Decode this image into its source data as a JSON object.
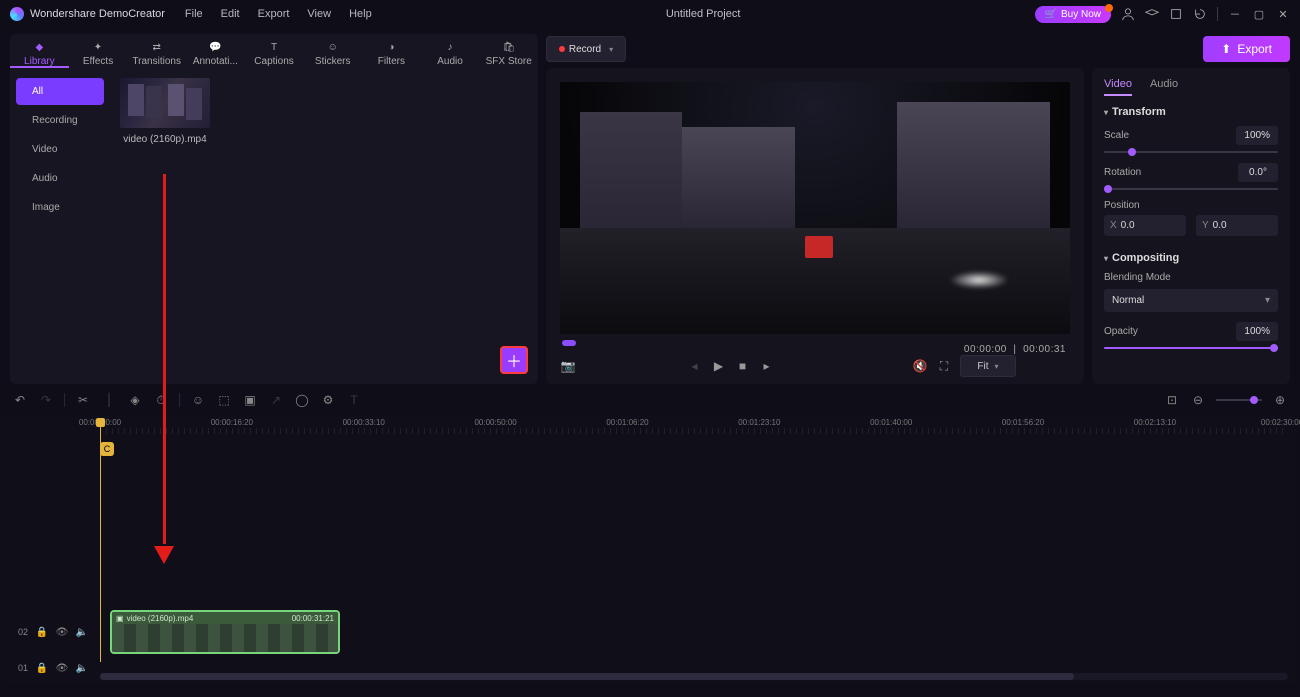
{
  "titlebar": {
    "app": "Wondershare DemoCreator",
    "menus": [
      "File",
      "Edit",
      "Export",
      "View",
      "Help"
    ],
    "project": "Untitled Project",
    "buy": "Buy Now"
  },
  "tabs": [
    {
      "id": "library",
      "label": "Library",
      "active": true
    },
    {
      "id": "effects",
      "label": "Effects"
    },
    {
      "id": "transitions",
      "label": "Transitions"
    },
    {
      "id": "annotations",
      "label": "Annotati..."
    },
    {
      "id": "captions",
      "label": "Captions"
    },
    {
      "id": "stickers",
      "label": "Stickers"
    },
    {
      "id": "filters",
      "label": "Filters"
    },
    {
      "id": "audio",
      "label": "Audio"
    },
    {
      "id": "sfx",
      "label": "SFX Store"
    }
  ],
  "record": {
    "label": "Record"
  },
  "export": {
    "label": "Export"
  },
  "library": {
    "categories": [
      {
        "label": "All",
        "active": true
      },
      {
        "label": "Recording"
      },
      {
        "label": "Video"
      },
      {
        "label": "Audio"
      },
      {
        "label": "Image"
      }
    ],
    "thumb_name": "video (2160p).mp4"
  },
  "preview": {
    "time_current": "00:00:00",
    "time_total": "00:00:31",
    "fit": "Fit"
  },
  "props": {
    "tabs": [
      "Video",
      "Audio"
    ],
    "transform": {
      "title": "Transform",
      "scale_label": "Scale",
      "scale_value": "100%",
      "rotation_label": "Rotation",
      "rotation_value": "0.0°",
      "position_label": "Position",
      "x_label": "X",
      "x_value": "0.0",
      "y_label": "Y",
      "y_value": "0.0"
    },
    "compositing": {
      "title": "Compositing",
      "blend_label": "Blending Mode",
      "blend_value": "Normal",
      "opacity_label": "Opacity",
      "opacity_value": "100%"
    }
  },
  "timeline": {
    "ticks": [
      "00:00:00:00",
      "00:00:16:20",
      "00:00:33:10",
      "00:00:50:00",
      "00:01:06:20",
      "00:01:23:10",
      "00:01:40:00",
      "00:01:56:20",
      "00:02:13:10",
      "00:02:30:00"
    ],
    "marker": "C",
    "track02": "02",
    "track01": "01",
    "clip": {
      "name": "video (2160p).mp4",
      "dur": "00:00:31:21"
    }
  }
}
